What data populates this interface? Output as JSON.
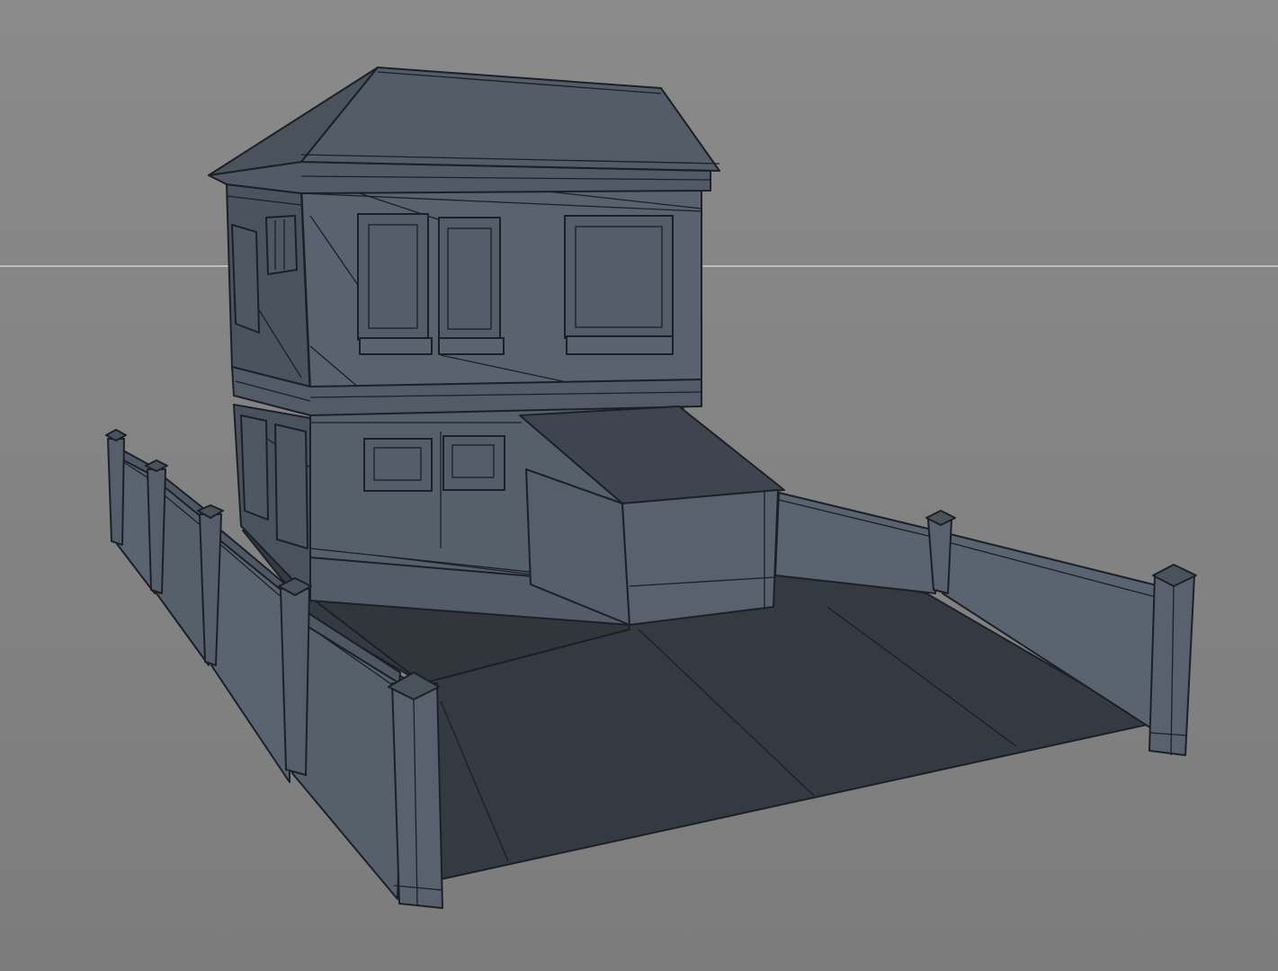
{
  "viewport": {
    "shading": "wireframe-on-shaded",
    "colors": {
      "background_top": "#8a8a8a",
      "background_bottom": "#7c7c7c",
      "horizon_line": "#bdbdbd",
      "mesh_light": "#5a6370",
      "mesh_mid": "#4e5661",
      "mesh_dark": "#3c434c",
      "ground": "#343a41",
      "wire": "#1c2026"
    }
  },
  "model": {
    "object_type": "house-with-walled-yard",
    "parts": [
      "hip-roof",
      "upper-floor",
      "lower-floor",
      "porch-awning",
      "porch-box",
      "yard-floor",
      "fence-walls",
      "fence-posts"
    ]
  }
}
